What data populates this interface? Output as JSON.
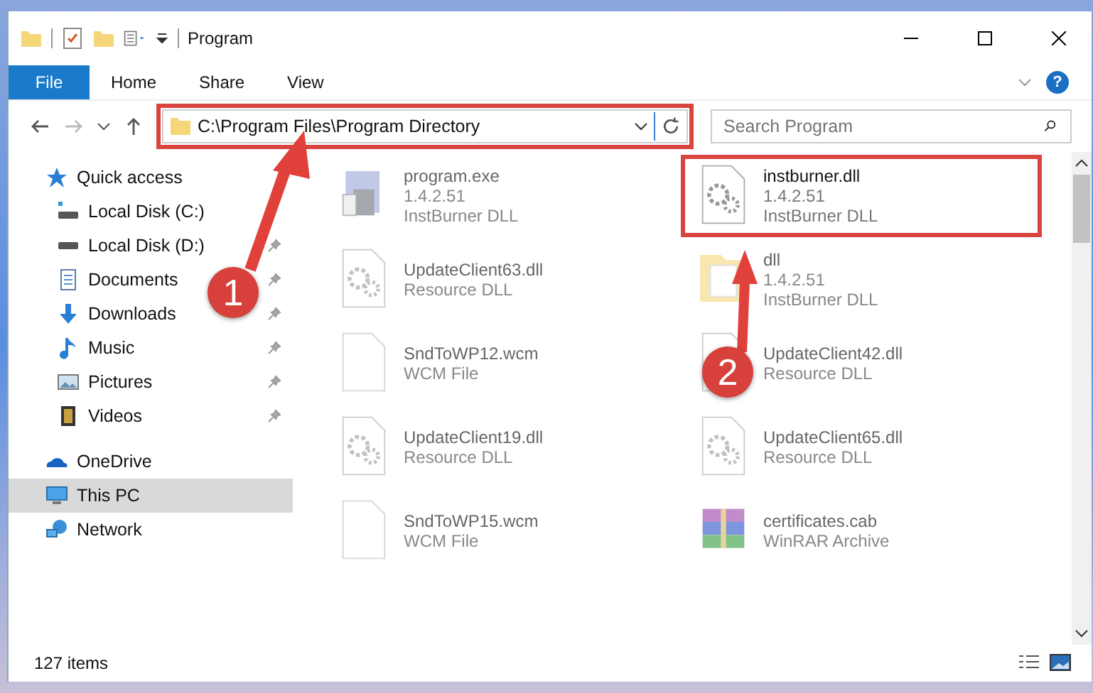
{
  "window": {
    "title": "Program"
  },
  "ribbon": {
    "tabs": [
      {
        "label": "File",
        "selected": true
      },
      {
        "label": "Home",
        "selected": false
      },
      {
        "label": "Share",
        "selected": false
      },
      {
        "label": "View",
        "selected": false
      }
    ],
    "help": "?"
  },
  "address": {
    "path": "C:\\Program Files\\Program Directory",
    "highlighted": true
  },
  "search": {
    "placeholder": "Search Program"
  },
  "sidebar": {
    "items": [
      {
        "label": "Quick access",
        "selected": false,
        "children": [
          {
            "label": "Local Disk (C:)",
            "pinned": false
          },
          {
            "label": "Local Disk (D:)",
            "pinned": true
          },
          {
            "label": "Documents",
            "pinned": true
          },
          {
            "label": "Downloads",
            "pinned": true
          },
          {
            "label": "Music",
            "pinned": true
          },
          {
            "label": "Pictures",
            "pinned": true
          },
          {
            "label": "Videos",
            "pinned": true
          }
        ]
      },
      {
        "label": "OneDrive",
        "selected": false
      },
      {
        "label": "This PC",
        "selected": true
      },
      {
        "label": "Network",
        "selected": false
      }
    ]
  },
  "files": [
    {
      "kind": "exe",
      "name": "program.exe",
      "details": [
        "1.4.2.51",
        "InstBurner DLL"
      ],
      "blurred": true,
      "highlighted": false
    },
    {
      "kind": "dll",
      "name": "instburner.dll",
      "details": [
        "1.4.2.51",
        "InstBurner DLL"
      ],
      "blurred": false,
      "highlighted": true
    },
    {
      "kind": "dll",
      "name": "UpdateClient63.dll",
      "details": [
        "Resource DLL"
      ],
      "blurred": true,
      "highlighted": false
    },
    {
      "kind": "folder",
      "name": "dll",
      "details": [
        "1.4.2.51",
        "InstBurner DLL"
      ],
      "blurred": true,
      "highlighted": false
    },
    {
      "kind": "file",
      "name": "SndToWP12.wcm",
      "details": [
        "WCM File"
      ],
      "blurred": true,
      "highlighted": false
    },
    {
      "kind": "dll",
      "name": "UpdateClient42.dll",
      "details": [
        "Resource DLL"
      ],
      "blurred": true,
      "highlighted": false
    },
    {
      "kind": "dll",
      "name": "UpdateClient19.dll",
      "details": [
        "Resource DLL"
      ],
      "blurred": true,
      "highlighted": false
    },
    {
      "kind": "dll",
      "name": "UpdateClient65.dll",
      "details": [
        "Resource DLL"
      ],
      "blurred": true,
      "highlighted": false
    },
    {
      "kind": "file",
      "name": "SndToWP15.wcm",
      "details": [
        "WCM File"
      ],
      "blurred": true,
      "highlighted": false
    },
    {
      "kind": "archive",
      "name": "certificates.cab",
      "details": [
        "WinRAR Archive"
      ],
      "blurred": true,
      "highlighted": false
    }
  ],
  "callouts": [
    {
      "number": "1"
    },
    {
      "number": "2"
    }
  ],
  "status_bar": {
    "count": "127 items"
  }
}
